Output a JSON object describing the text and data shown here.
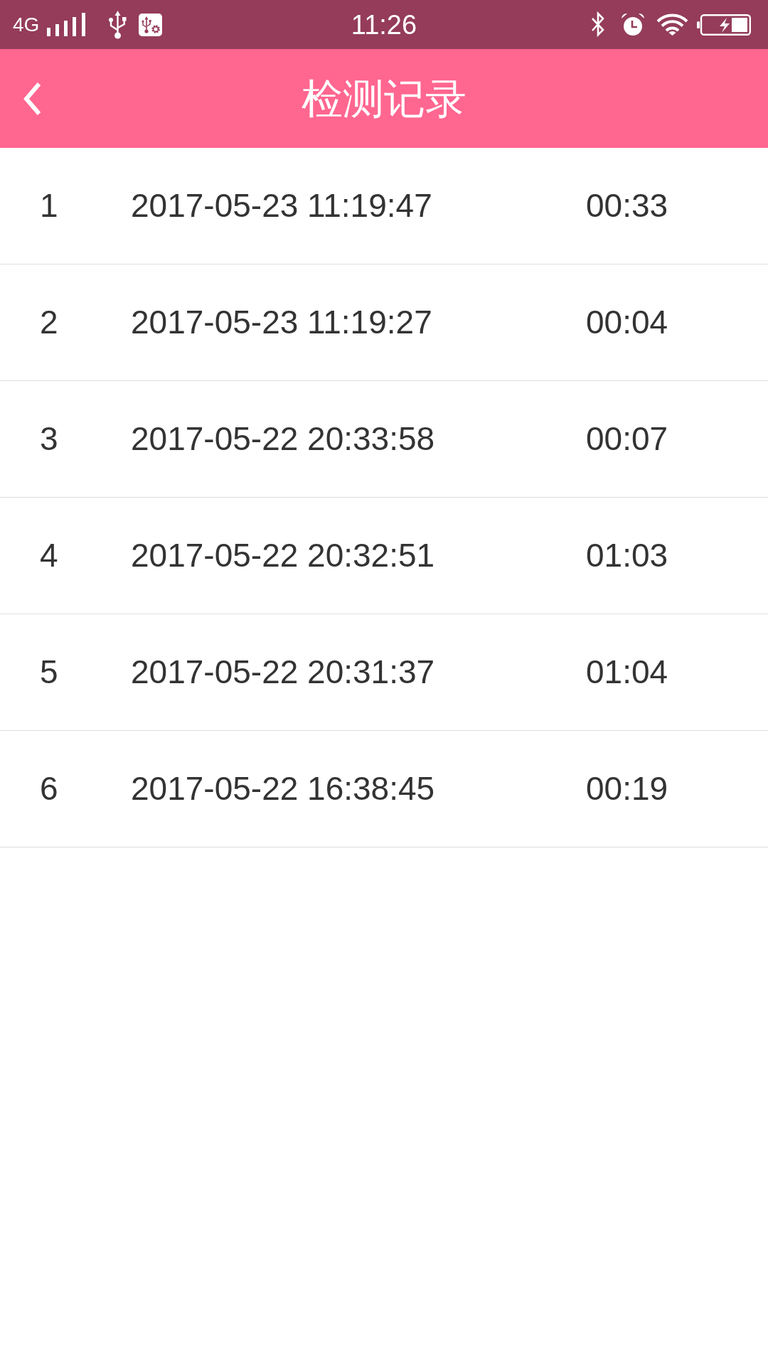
{
  "status_bar": {
    "network": "4G",
    "time": "11:26"
  },
  "header": {
    "title": "检测记录"
  },
  "records": [
    {
      "index": "1",
      "datetime": "2017-05-23 11:19:47",
      "duration": "00:33"
    },
    {
      "index": "2",
      "datetime": "2017-05-23 11:19:27",
      "duration": "00:04"
    },
    {
      "index": "3",
      "datetime": "2017-05-22 20:33:58",
      "duration": "00:07"
    },
    {
      "index": "4",
      "datetime": "2017-05-22 20:32:51",
      "duration": "01:03"
    },
    {
      "index": "5",
      "datetime": "2017-05-22 20:31:37",
      "duration": "01:04"
    },
    {
      "index": "6",
      "datetime": "2017-05-22 16:38:45",
      "duration": "00:19"
    }
  ]
}
